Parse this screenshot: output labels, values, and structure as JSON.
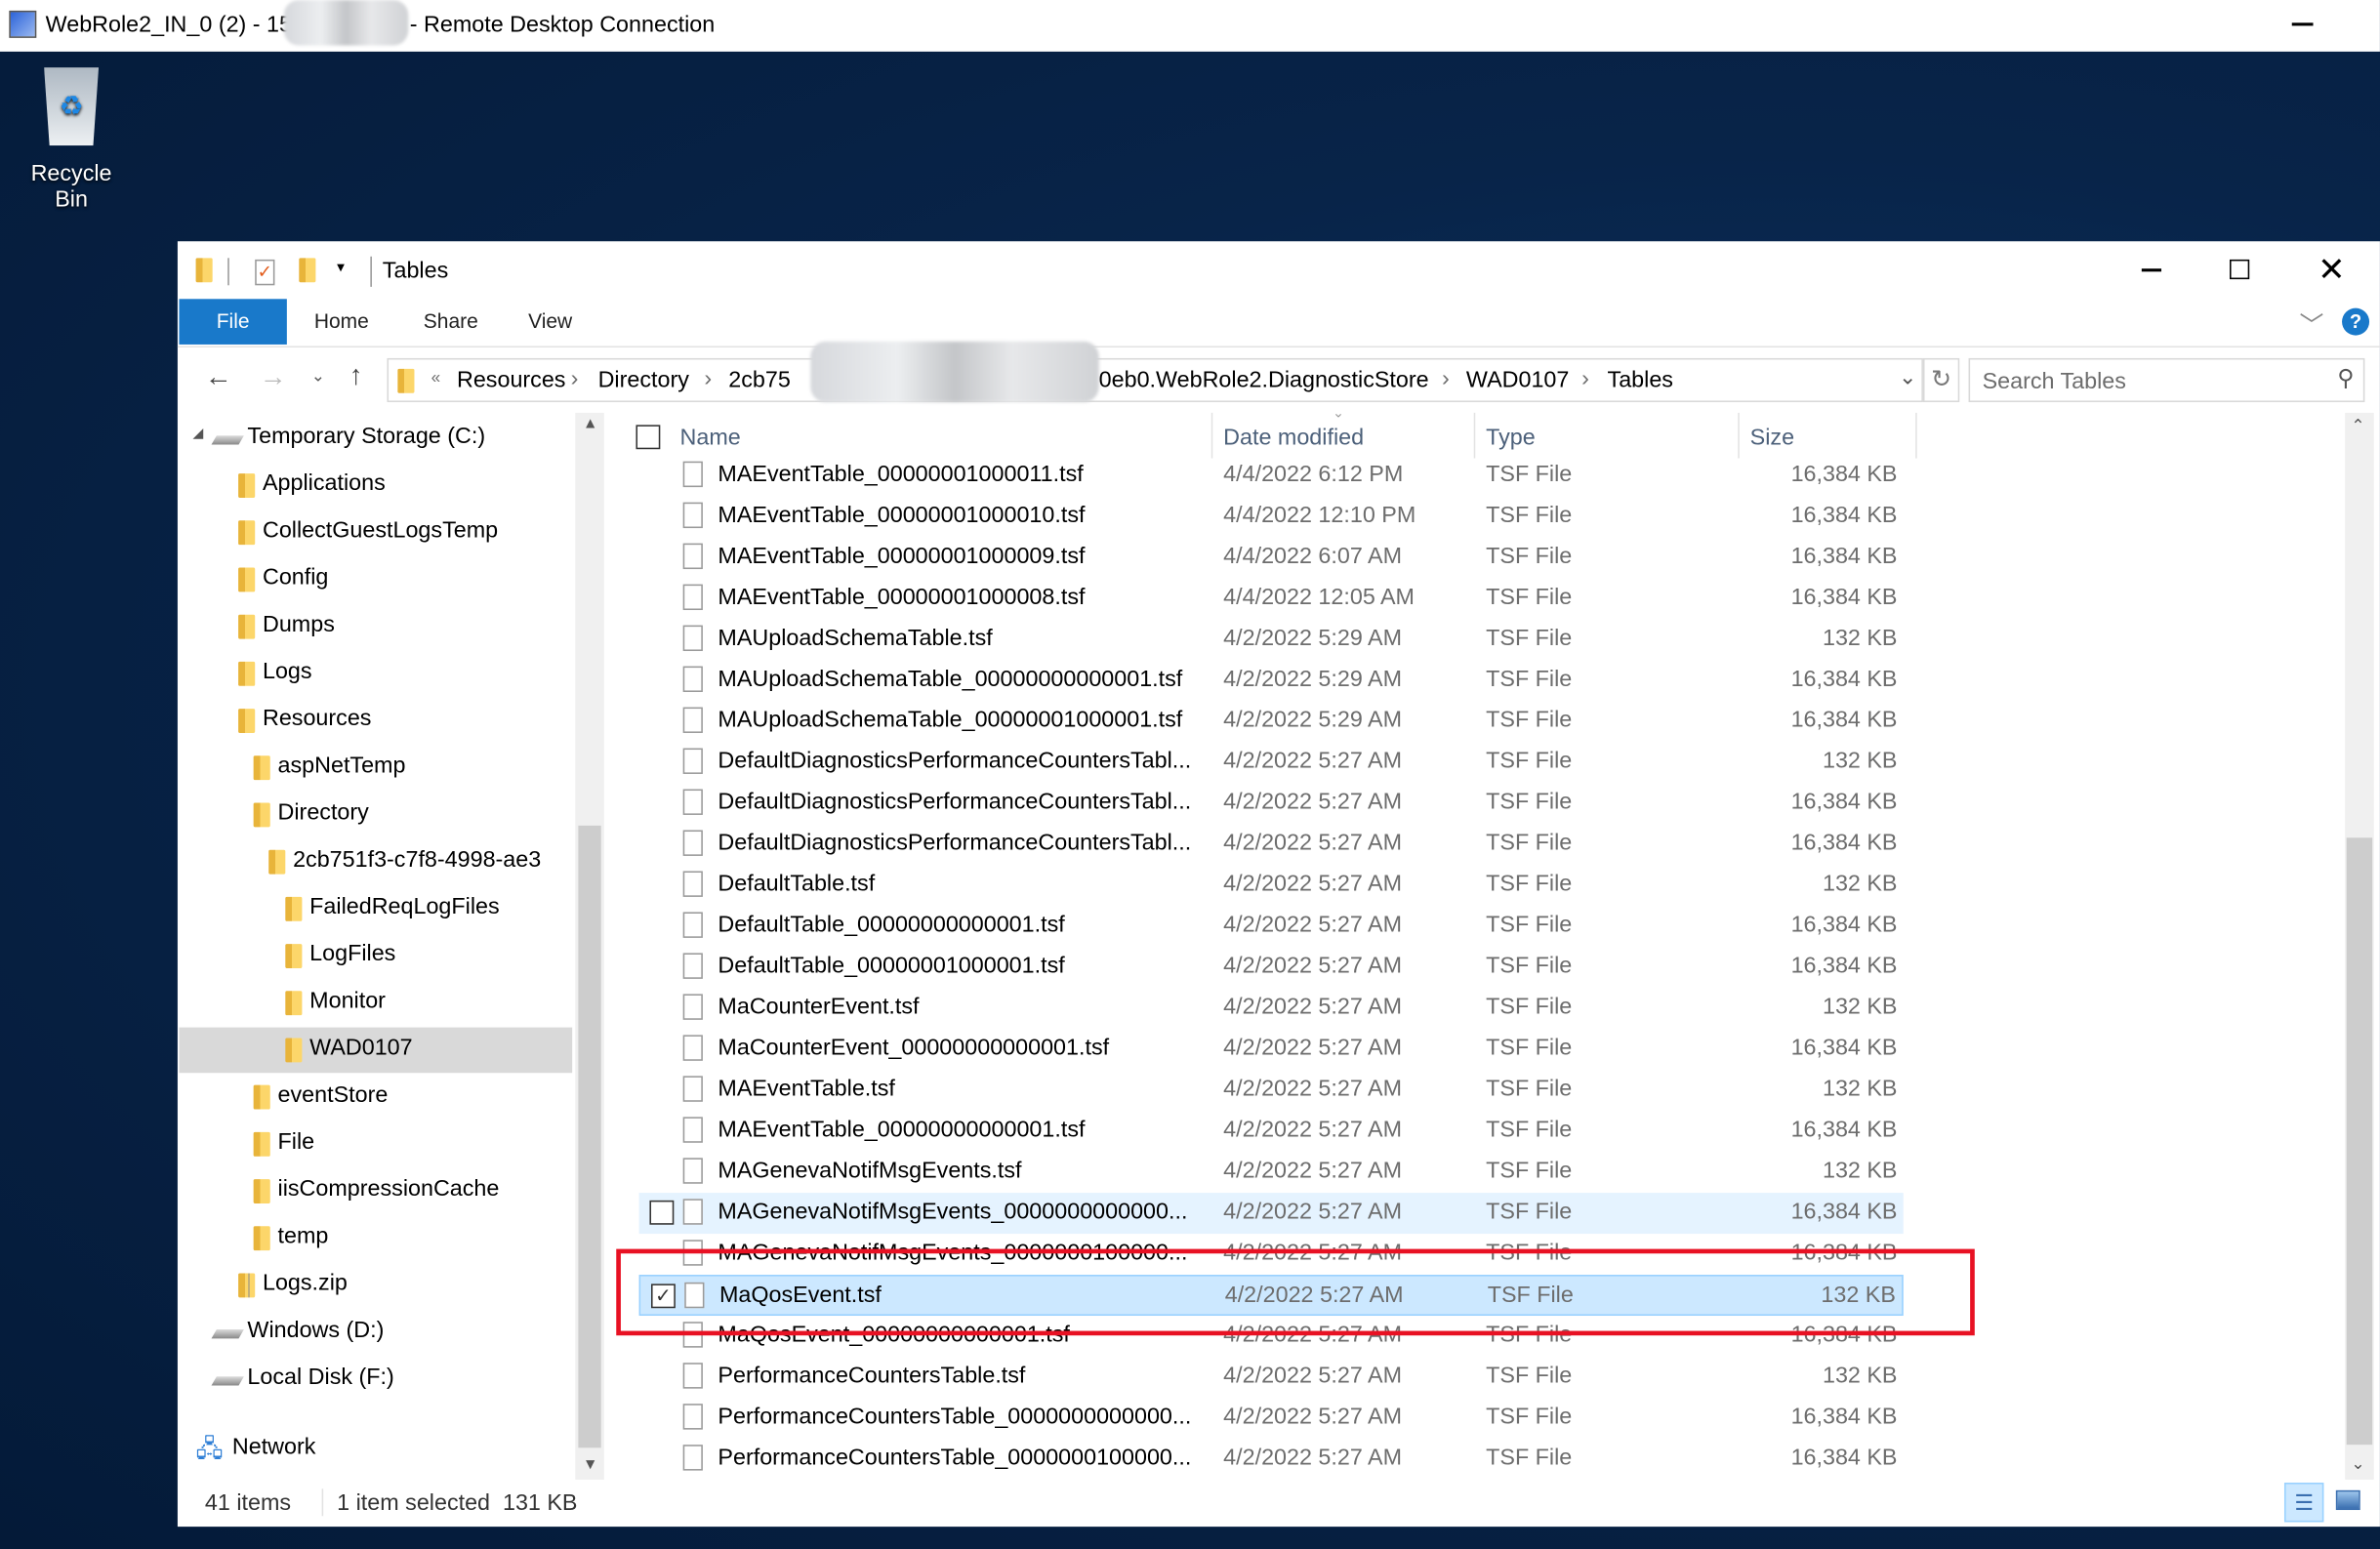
{
  "rdp": {
    "title_start": "WebRole2_IN_0 (2) - 15",
    "title_end": "- Remote Desktop Connection",
    "minimize_glyph": "—"
  },
  "desktop": {
    "recycle_bin_label": "Recycle Bin"
  },
  "explorer": {
    "title": "Tables",
    "ribbon_tabs": [
      "File",
      "Home",
      "Share",
      "View"
    ],
    "address": {
      "overflow": "«",
      "crumbs": [
        "Resources",
        "Directory",
        "2cb75"
      ],
      "crumbs_after": [
        "0eb0.WebRole2.DiagnosticStore",
        "WAD0107",
        "Tables"
      ]
    },
    "search_placeholder": "Search Tables",
    "columns": [
      "Name",
      "Date modified",
      "Type",
      "Size"
    ],
    "nav_tree": [
      {
        "label": "Temporary Storage (C:)",
        "icon": "drive-icon",
        "level": 0
      },
      {
        "label": "Applications",
        "icon": "folder-icon",
        "level": 1
      },
      {
        "label": "CollectGuestLogsTemp",
        "icon": "folder-icon",
        "level": 1
      },
      {
        "label": "Config",
        "icon": "folder-icon",
        "level": 1
      },
      {
        "label": "Dumps",
        "icon": "folder-icon",
        "level": 1
      },
      {
        "label": "Logs",
        "icon": "folder-icon",
        "level": 1
      },
      {
        "label": "Resources",
        "icon": "folder-icon",
        "level": 1
      },
      {
        "label": "aspNetTemp",
        "icon": "folder-icon",
        "level": 2
      },
      {
        "label": "Directory",
        "icon": "folder-icon",
        "level": 2
      },
      {
        "label": "2cb751f3-c7f8-4998-ae3",
        "icon": "folder-icon",
        "level": 3
      },
      {
        "label": "FailedReqLogFiles",
        "icon": "folder-icon",
        "level": 4
      },
      {
        "label": "LogFiles",
        "icon": "folder-icon",
        "level": 4
      },
      {
        "label": "Monitor",
        "icon": "folder-icon",
        "level": 4
      },
      {
        "label": "WAD0107",
        "icon": "folder-icon",
        "level": 4,
        "selected": true
      },
      {
        "label": "eventStore",
        "icon": "folder-icon",
        "level": 2
      },
      {
        "label": "File",
        "icon": "folder-icon",
        "level": 2
      },
      {
        "label": "iisCompressionCache",
        "icon": "folder-icon",
        "level": 2
      },
      {
        "label": "temp",
        "icon": "folder-icon",
        "level": 2
      },
      {
        "label": "Logs.zip",
        "icon": "zip-icon",
        "level": 1
      },
      {
        "label": "Windows (D:)",
        "icon": "drive-icon",
        "level": 0
      },
      {
        "label": "Local Disk (F:)",
        "icon": "drive-icon",
        "level": 0
      },
      {
        "label": "Network",
        "icon": "network-icon",
        "level": -1
      }
    ],
    "files": [
      {
        "name": "MAEventTable_00000001000011.tsf",
        "date": "4/4/2022 6:12 PM",
        "type": "TSF File",
        "size": "16,384 KB"
      },
      {
        "name": "MAEventTable_00000001000010.tsf",
        "date": "4/4/2022 12:10 PM",
        "type": "TSF File",
        "size": "16,384 KB"
      },
      {
        "name": "MAEventTable_00000001000009.tsf",
        "date": "4/4/2022 6:07 AM",
        "type": "TSF File",
        "size": "16,384 KB"
      },
      {
        "name": "MAEventTable_00000001000008.tsf",
        "date": "4/4/2022 12:05 AM",
        "type": "TSF File",
        "size": "16,384 KB"
      },
      {
        "name": "MAUploadSchemaTable.tsf",
        "date": "4/2/2022 5:29 AM",
        "type": "TSF File",
        "size": "132 KB"
      },
      {
        "name": "MAUploadSchemaTable_00000000000001.tsf",
        "date": "4/2/2022 5:29 AM",
        "type": "TSF File",
        "size": "16,384 KB"
      },
      {
        "name": "MAUploadSchemaTable_00000001000001.tsf",
        "date": "4/2/2022 5:29 AM",
        "type": "TSF File",
        "size": "16,384 KB"
      },
      {
        "name": "DefaultDiagnosticsPerformanceCountersTabl...",
        "date": "4/2/2022 5:27 AM",
        "type": "TSF File",
        "size": "132 KB"
      },
      {
        "name": "DefaultDiagnosticsPerformanceCountersTabl...",
        "date": "4/2/2022 5:27 AM",
        "type": "TSF File",
        "size": "16,384 KB"
      },
      {
        "name": "DefaultDiagnosticsPerformanceCountersTabl...",
        "date": "4/2/2022 5:27 AM",
        "type": "TSF File",
        "size": "16,384 KB"
      },
      {
        "name": "DefaultTable.tsf",
        "date": "4/2/2022 5:27 AM",
        "type": "TSF File",
        "size": "132 KB"
      },
      {
        "name": "DefaultTable_00000000000001.tsf",
        "date": "4/2/2022 5:27 AM",
        "type": "TSF File",
        "size": "16,384 KB"
      },
      {
        "name": "DefaultTable_00000001000001.tsf",
        "date": "4/2/2022 5:27 AM",
        "type": "TSF File",
        "size": "16,384 KB"
      },
      {
        "name": "MaCounterEvent.tsf",
        "date": "4/2/2022 5:27 AM",
        "type": "TSF File",
        "size": "132 KB"
      },
      {
        "name": "MaCounterEvent_00000000000001.tsf",
        "date": "4/2/2022 5:27 AM",
        "type": "TSF File",
        "size": "16,384 KB"
      },
      {
        "name": "MAEventTable.tsf",
        "date": "4/2/2022 5:27 AM",
        "type": "TSF File",
        "size": "132 KB"
      },
      {
        "name": "MAEventTable_00000000000001.tsf",
        "date": "4/2/2022 5:27 AM",
        "type": "TSF File",
        "size": "16,384 KB"
      },
      {
        "name": "MAGenevaNotifMsgEvents.tsf",
        "date": "4/2/2022 5:27 AM",
        "type": "TSF File",
        "size": "132 KB"
      },
      {
        "name": "MAGenevaNotifMsgEvents_0000000000000...",
        "date": "4/2/2022 5:27 AM",
        "type": "TSF File",
        "size": "16,384 KB",
        "hover": true
      },
      {
        "name": "MAGenevaNotifMsgEvents_0000000100000...",
        "date": "4/2/2022 5:27 AM",
        "type": "TSF File",
        "size": "16,384 KB"
      },
      {
        "name": "MaQosEvent.tsf",
        "date": "4/2/2022 5:27 AM",
        "type": "TSF File",
        "size": "132 KB",
        "selected": true
      },
      {
        "name": "MaQosEvent_00000000000001.tsf",
        "date": "4/2/2022 5:27 AM",
        "type": "TSF File",
        "size": "16,384 KB"
      },
      {
        "name": "PerformanceCountersTable.tsf",
        "date": "4/2/2022 5:27 AM",
        "type": "TSF File",
        "size": "132 KB"
      },
      {
        "name": "PerformanceCountersTable_0000000000000...",
        "date": "4/2/2022 5:27 AM",
        "type": "TSF File",
        "size": "16,384 KB"
      },
      {
        "name": "PerformanceCountersTable_0000000100000...",
        "date": "4/2/2022 5:27 AM",
        "type": "TSF File",
        "size": "16,384 KB"
      }
    ],
    "status": {
      "items": "41 items",
      "selected": "1 item selected  131 KB"
    }
  },
  "colors": {
    "accent": "#1979ca",
    "selection": "#cce8ff",
    "hover": "#e5f3ff",
    "highlight_box": "#e81123"
  }
}
